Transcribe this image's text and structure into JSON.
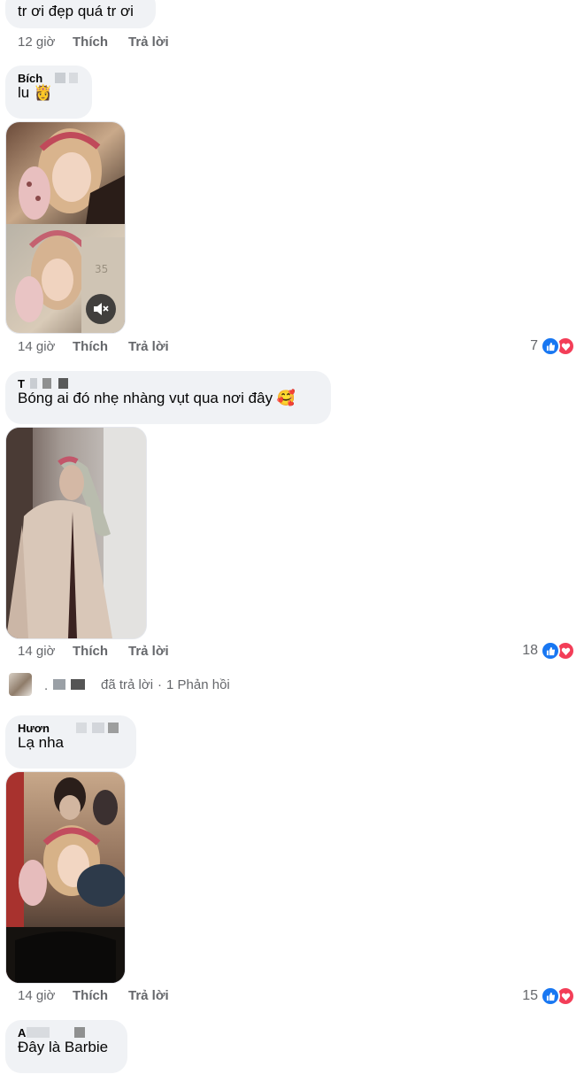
{
  "comments": [
    {
      "text": "tr ơi đẹp quá tr ơi",
      "time": "12 giờ",
      "like": "Thích",
      "reply": "Trả lời"
    },
    {
      "author": "Bích",
      "text": "lu 👸",
      "time": "14 giờ",
      "like": "Thích",
      "reply": "Trả lời",
      "reaction_count": "7",
      "reactions": [
        "like-icon",
        "love-icon"
      ]
    },
    {
      "author": "T",
      "text": "Bóng ai đó nhẹ nhàng vụt qua nơi đây 🥰",
      "time": "14 giờ",
      "like": "Thích",
      "reply": "Trả lời",
      "reaction_count": "18",
      "reactions": [
        "like-icon",
        "love-icon"
      ],
      "replies_summary": {
        "name": ".",
        "action": "đã trả lời",
        "separator": "·",
        "count_label": "1 Phản hồi"
      }
    },
    {
      "author": "Hươn",
      "text": "Lạ nha",
      "time": "14 giờ",
      "like": "Thích",
      "reply": "Trả lời",
      "reaction_count": "15",
      "reactions": [
        "like-icon",
        "love-icon"
      ]
    },
    {
      "author": "A",
      "text": "Đây là Barbie"
    }
  ],
  "colors": {
    "bubble": "#f0f2f5",
    "meta_text": "#65676b",
    "like_blue": "#1877f2",
    "love_red": "#f33e58"
  }
}
